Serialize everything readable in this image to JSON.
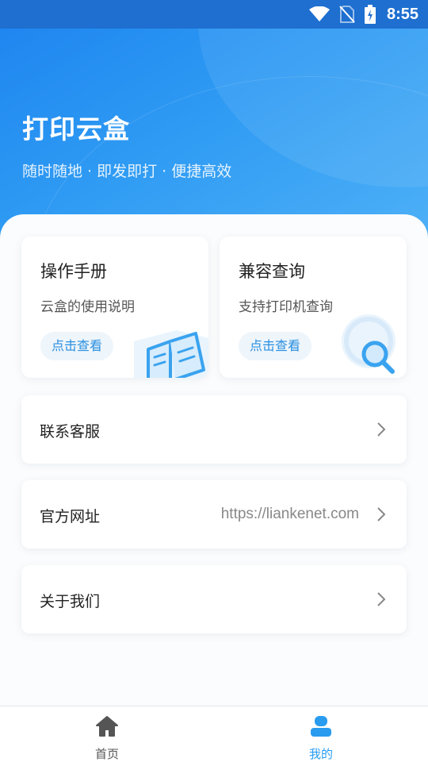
{
  "status_bar": {
    "time": "8:55",
    "icons": [
      "wifi-icon",
      "no-sim-icon",
      "battery-charging-icon"
    ]
  },
  "header": {
    "title": "打印云盒",
    "subtitle": "随时随地 · 即发即打 · 便捷高效"
  },
  "cards": [
    {
      "title": "操作手册",
      "desc": "云盒的使用说明",
      "button": "点击查看",
      "icon": "book-icon"
    },
    {
      "title": "兼容查询",
      "desc": "支持打印机查询",
      "button": "点击查看",
      "icon": "magnifier-icon"
    }
  ],
  "menu": [
    {
      "label": "联系客服",
      "value": ""
    },
    {
      "label": "官方网址",
      "value": "https://liankenet.com"
    },
    {
      "label": "关于我们",
      "value": ""
    }
  ],
  "tabs": [
    {
      "label": "首页",
      "icon": "home-icon",
      "active": false
    },
    {
      "label": "我的",
      "icon": "user-icon",
      "active": true
    }
  ],
  "colors": {
    "accent": "#2a9cf0",
    "tab_inactive": "#555555",
    "header_gradient": [
      "#1f86f0",
      "#4fb1f7"
    ]
  }
}
